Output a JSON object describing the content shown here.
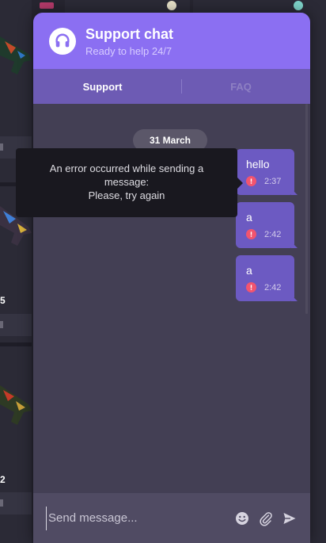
{
  "colors": {
    "header_bg": "#8b6ff2",
    "tabs_bg": "#6d5bb4",
    "chat_bg": "#433f54",
    "message_bg": "#6c5ac2",
    "error_red": "#f2546f",
    "tooltip_bg": "#19181f"
  },
  "background": {
    "prices": [
      "5",
      "2"
    ]
  },
  "header": {
    "title": "Support chat",
    "subtitle": "Ready to help 24/7",
    "logo_icon": "headset-icon"
  },
  "tabs": [
    {
      "label": "Support",
      "active": true
    },
    {
      "label": "FAQ",
      "active": false
    }
  ],
  "chat": {
    "date": "31 March",
    "messages": [
      {
        "text": "hello",
        "time": "2:37",
        "status": "error"
      },
      {
        "text": "a",
        "time": "2:42",
        "status": "error"
      },
      {
        "text": "a",
        "time": "2:42",
        "status": "error"
      }
    ]
  },
  "tooltip": {
    "line1": "An error occurred while sending a message:",
    "line2": "Please, try again"
  },
  "input": {
    "placeholder": "Send message...",
    "value": "",
    "icons": [
      "emoji-icon",
      "attachment-icon",
      "send-icon"
    ]
  }
}
